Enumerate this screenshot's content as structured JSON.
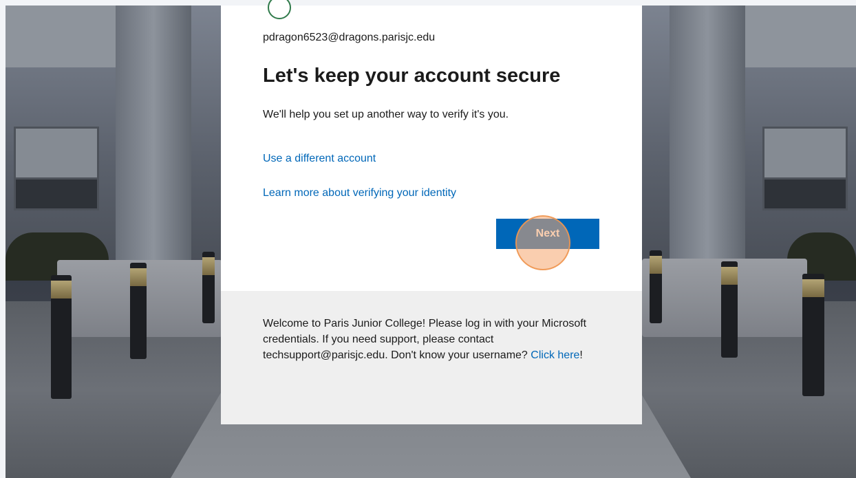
{
  "account": {
    "email": "pdragon6523@dragons.parisjc.edu"
  },
  "heading": "Let's keep your account secure",
  "description": "We'll help you set up another way to verify it's you.",
  "links": {
    "different_account": "Use a different account",
    "learn_more": "Learn more about verifying your identity"
  },
  "buttons": {
    "next": "Next"
  },
  "footer": {
    "text": "Welcome to Paris Junior College! Please log in with your Microsoft credentials. If you need support, please contact techsupport@parisjc.edu. Don't know your username? ",
    "link_text": "Click here",
    "suffix": "!"
  },
  "colors": {
    "accent": "#0067b8",
    "button_text": "#ffffff",
    "footer_bg": "#efefef"
  },
  "icons": {
    "logo": "college-logo-icon"
  }
}
